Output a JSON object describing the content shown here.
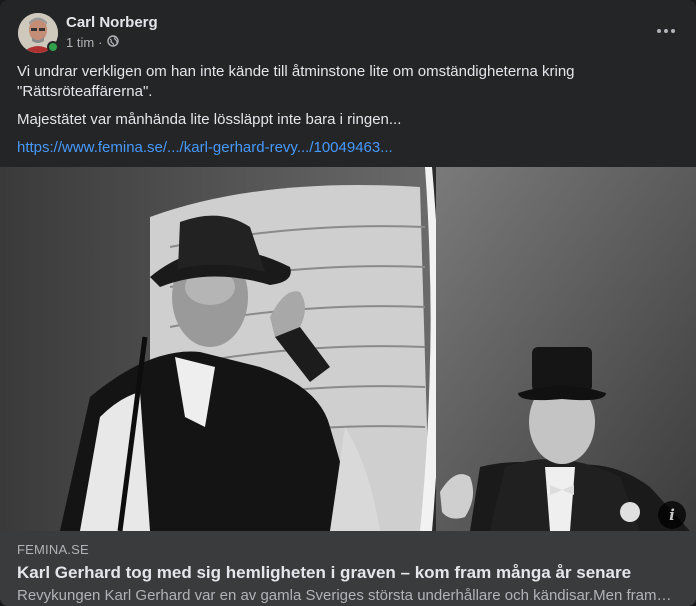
{
  "post": {
    "author": "Carl Norberg",
    "time": "1 tim",
    "audience_icon": "globe-icon",
    "more_icon": "more-dots-icon",
    "paragraphs": [
      "Vi undrar verkligen om han inte kände till åtminstone lite om omständigheterna kring \"Rättsröteaffärerna\".",
      "Majestätet var månhända lite lössläppt inte bara i ringen..."
    ],
    "link": "https://www.femina.se/.../karl-gerhard-revy.../10049463..."
  },
  "link_preview": {
    "domain": "FEMINA.SE",
    "title": "Karl Gerhard tog med sig hemligheten i graven – kom fram många år senare",
    "description": "Revykungen Karl Gerhard var en av gamla Sveriges största underhållare och kändisar.Men fram…",
    "info_icon": "info-icon",
    "info_label": "i"
  },
  "colors": {
    "background": "#242526",
    "text": "#e4e6eb",
    "secondary": "#b0b3b8",
    "link": "#4599ff",
    "online": "#31a24c"
  }
}
